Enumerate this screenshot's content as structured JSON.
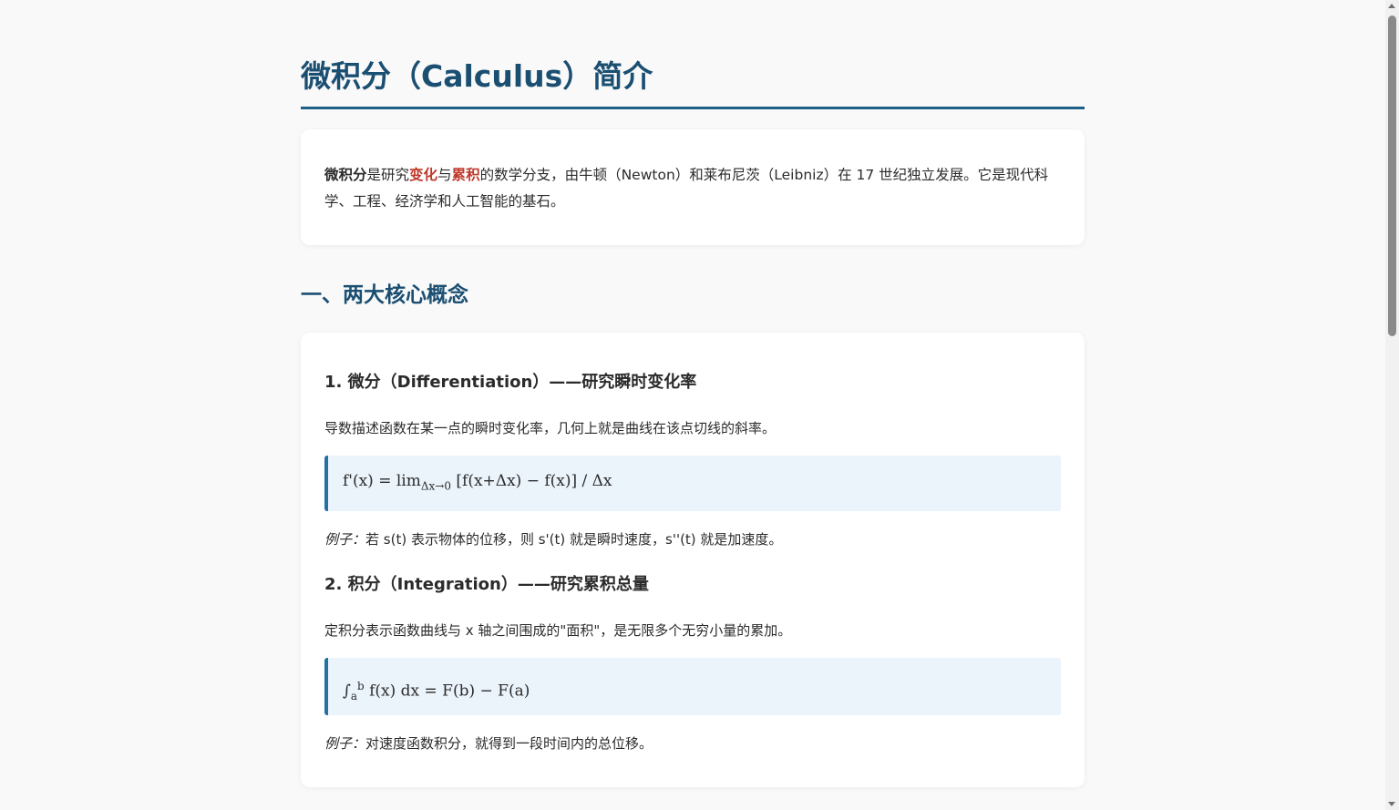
{
  "title": "微积分（Calculus）简介",
  "intro": {
    "term": "微积分",
    "text_a": "是研究",
    "highlight_1": "变化",
    "text_b": "与",
    "highlight_2": "累积",
    "text_c": "的数学分支，由牛顿（Newton）和莱布尼茨（Leibniz）在 17 世纪独立发展。它是现代科学、工程、经济学和人工智能的基石。"
  },
  "section1": {
    "heading": "一、两大核心概念",
    "differentiation": {
      "heading": "1. 微分（Differentiation）——研究瞬时变化率",
      "description": "导数描述函数在某一点的瞬时变化率，几何上就是曲线在该点切线的斜率。",
      "formula_left": "f'(x) = lim",
      "formula_sub": "Δx→0",
      "formula_right": " [f(x+Δx) − f(x)] / Δx",
      "example_label": "例子：",
      "example_text": "若 s(t) 表示物体的位移，则 s'(t) 就是瞬时速度，s''(t) 就是加速度。"
    },
    "integration": {
      "heading": "2. 积分（Integration）——研究累积总量",
      "description": "定积分表示函数曲线与 x 轴之间围成的\"面积\"，是无限多个无穷小量的累加。",
      "formula_integral": "∫",
      "formula_lower": "a",
      "formula_upper": "b",
      "formula_right": " f(x) dx = F(b) − F(a)",
      "example_label": "例子：",
      "example_text": "对速度函数积分，就得到一段时间内的总位移。"
    }
  }
}
